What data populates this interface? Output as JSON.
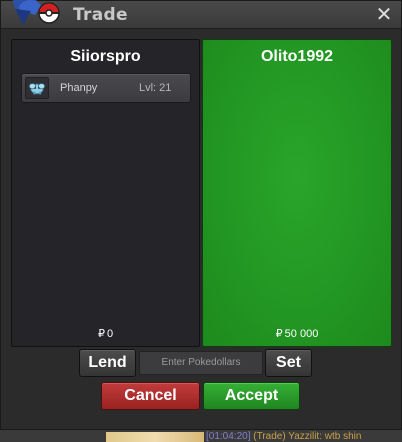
{
  "window": {
    "title": "Trade",
    "close_label": "✕",
    "logo_icon": "pokeball-logo-icon"
  },
  "left_panel": {
    "player_name": "Siiorspro",
    "items": [
      {
        "icon": "phanpy-icon",
        "name": "Phanpy",
        "level": "Lvl: 21"
      }
    ],
    "money_symbol": "₽",
    "money": "0"
  },
  "right_panel": {
    "player_name": "Olito1992",
    "money_symbol": "₽",
    "money": "50 000"
  },
  "controls": {
    "lend_label": "Lend",
    "amount_placeholder": "Enter Pokedollars",
    "set_label": "Set",
    "cancel_label": "Cancel",
    "accept_label": "Accept"
  },
  "chat": {
    "time": "[01:04:20]",
    "message": " (Trade) Yazzilit: wtb shin"
  },
  "colors": {
    "accept_green": "#239b23",
    "cancel_red": "#b03030",
    "panel_dark": "#252428"
  }
}
